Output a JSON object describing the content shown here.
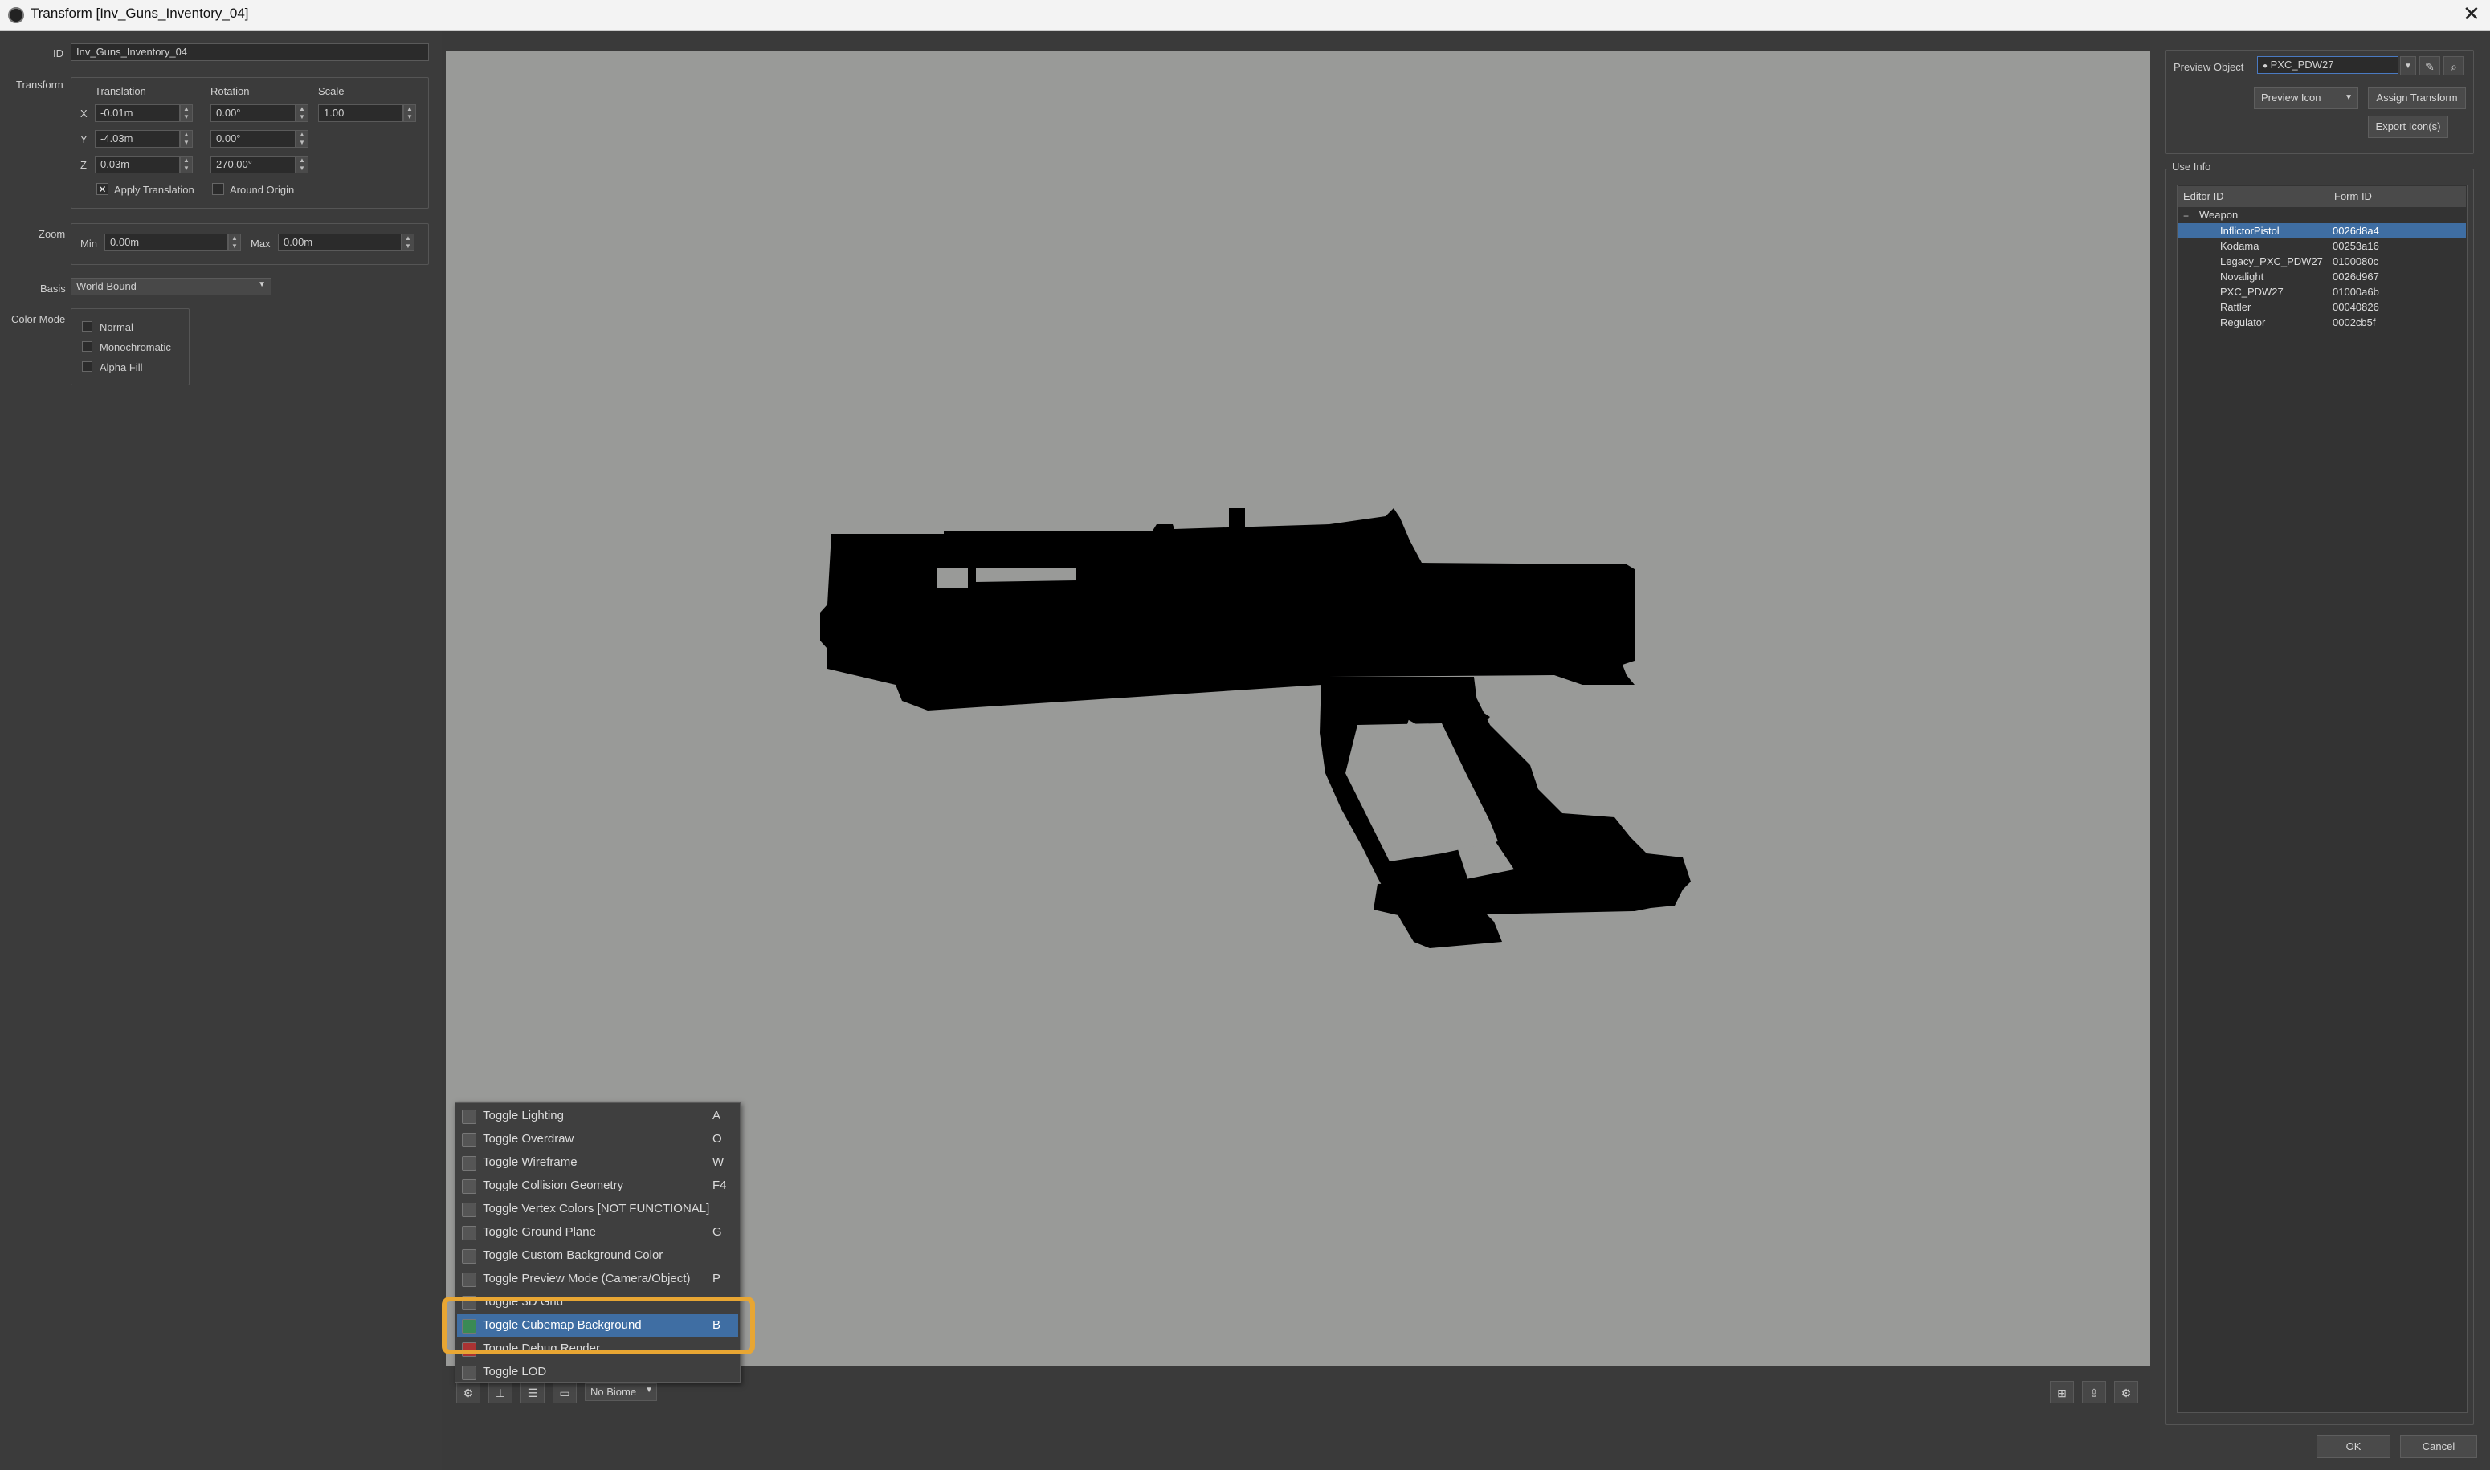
{
  "window": {
    "title": "Transform [Inv_Guns_Inventory_04]",
    "close_glyph": "✕"
  },
  "left": {
    "id_label": "ID",
    "id_value": "Inv_Guns_Inventory_04",
    "transform_label": "Transform",
    "col_translation": "Translation",
    "col_rotation": "Rotation",
    "col_scale": "Scale",
    "axes": [
      "X",
      "Y",
      "Z"
    ],
    "translation": [
      "-0.01m",
      "-4.03m",
      "0.03m"
    ],
    "rotation": [
      "0.00°",
      "0.00°",
      "270.00°"
    ],
    "scale": "1.00",
    "apply_translation_label": "Apply Translation",
    "apply_translation_checked": true,
    "around_origin_label": "Around Origin",
    "around_origin_checked": false,
    "zoom_label": "Zoom",
    "zoom_min_label": "Min",
    "zoom_min_value": "0.00m",
    "zoom_max_label": "Max",
    "zoom_max_value": "0.00m",
    "basis_label": "Basis",
    "basis_value": "World Bound",
    "color_mode_label": "Color Mode",
    "color_modes": [
      "Normal",
      "Monochromatic",
      "Alpha Fill"
    ]
  },
  "viewport": {
    "background_color": "#999a98",
    "silhouette_color": "#000000",
    "biome_value": "No Biome"
  },
  "menu": {
    "items": [
      {
        "label": "Toggle Lighting",
        "key": "A",
        "icon": "lightbulb-icon"
      },
      {
        "label": "Toggle Overdraw",
        "key": "O",
        "icon": "overdraw-icon"
      },
      {
        "label": "Toggle Wireframe",
        "key": "W",
        "icon": "wireframe-icon"
      },
      {
        "label": "Toggle Collision Geometry",
        "key": "F4",
        "icon": "collision-icon"
      },
      {
        "label": "Toggle Vertex Colors [NOT FUNCTIONAL]",
        "key": "",
        "icon": "vertex-colors-icon"
      },
      {
        "label": "Toggle Ground Plane",
        "key": "G",
        "icon": "ground-plane-icon"
      },
      {
        "label": "Toggle Custom Background Color",
        "key": "",
        "icon": "palette-icon"
      },
      {
        "label": "Toggle Preview Mode (Camera/Object)",
        "key": "P",
        "icon": "camera-icon"
      },
      {
        "label": "Toggle 3D Grid",
        "key": "",
        "icon": "grid-icon"
      },
      {
        "label": "Toggle Cubemap Background",
        "key": "B",
        "icon": "cubemap-icon"
      },
      {
        "label": "Toggle Debug Render",
        "key": "",
        "icon": "debug-icon"
      },
      {
        "label": "Toggle LOD",
        "key": "",
        "icon": "lod-icon"
      }
    ],
    "selected_index": 9,
    "highlight_color": "#e8a633"
  },
  "right": {
    "preview_object_label": "Preview Object",
    "preview_object_value": "PXC_PDW27",
    "preview_icon_label": "Preview Icon",
    "assign_transform_label": "Assign Transform",
    "export_icons_label": "Export Icon(s)",
    "use_info_label": "Use Info",
    "col_editor_id": "Editor ID",
    "col_form_id": "Form ID",
    "group_label": "Weapon",
    "rows": [
      {
        "editor_id": "InflictorPistol",
        "form_id": "0026d8a4"
      },
      {
        "editor_id": "Kodama",
        "form_id": "00253a16"
      },
      {
        "editor_id": "Legacy_PXC_PDW27",
        "form_id": "0100080c"
      },
      {
        "editor_id": "Novalight",
        "form_id": "0026d967"
      },
      {
        "editor_id": "PXC_PDW27",
        "form_id": "01000a6b"
      },
      {
        "editor_id": "Rattler",
        "form_id": "00040826"
      },
      {
        "editor_id": "Regulator",
        "form_id": "0002cb5f"
      }
    ],
    "selected_row": 0
  },
  "footer": {
    "ok_label": "OK",
    "cancel_label": "Cancel"
  }
}
